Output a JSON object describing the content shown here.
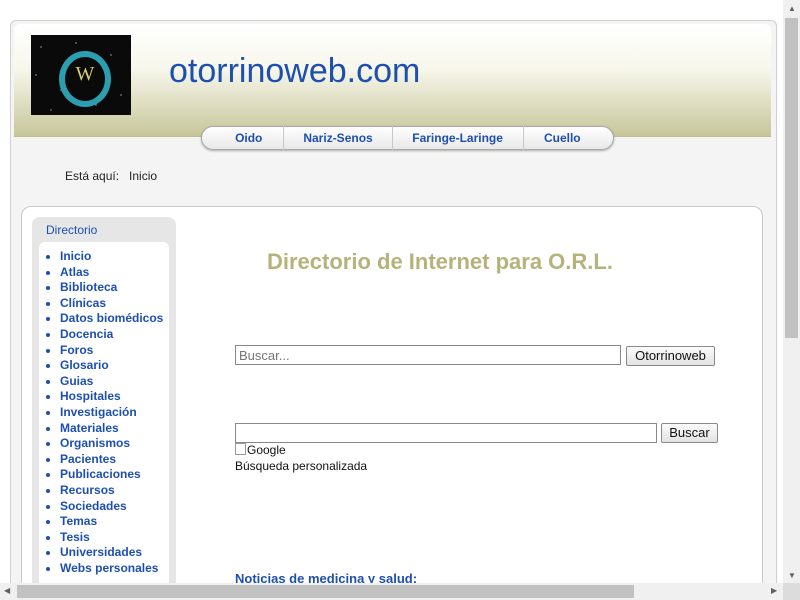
{
  "header": {
    "logo_letter": "W",
    "site_title": "otorrinoweb.com"
  },
  "nav": [
    {
      "label": "Oido"
    },
    {
      "label": "Nariz-Senos"
    },
    {
      "label": "Faringe-Laringe"
    },
    {
      "label": "Cuello"
    }
  ],
  "breadcrumb": {
    "prefix": "Está aquí:",
    "current": "Inicio"
  },
  "sidebar": {
    "title": "Directorio",
    "items": [
      "Inicio",
      "Atlas",
      "Biblioteca",
      "Clínicas",
      "Datos biomédicos",
      "Docencia",
      "Foros",
      "Glosario",
      "Guias",
      "Hospitales",
      "Investigación",
      "Materiales",
      "Organismos",
      "Pacientes",
      "Publicaciones",
      "Recursos",
      "Sociedades",
      "Temas",
      "Tesis",
      "Universidades",
      "Webs personales"
    ]
  },
  "main": {
    "title": "Directorio de Internet para O.R.L.",
    "site_search": {
      "placeholder": "Buscar...",
      "button": "Otorrinoweb"
    },
    "google_search": {
      "value": "",
      "button": "Buscar",
      "logo_alt": "Google",
      "caption": "Búsqueda personalizada"
    },
    "news_title": "Noticias de medicina y salud:"
  },
  "colors": {
    "link": "#1d4fb0",
    "title_olive": "#b5b37a",
    "header_gradient_end": "#c7c69a"
  }
}
